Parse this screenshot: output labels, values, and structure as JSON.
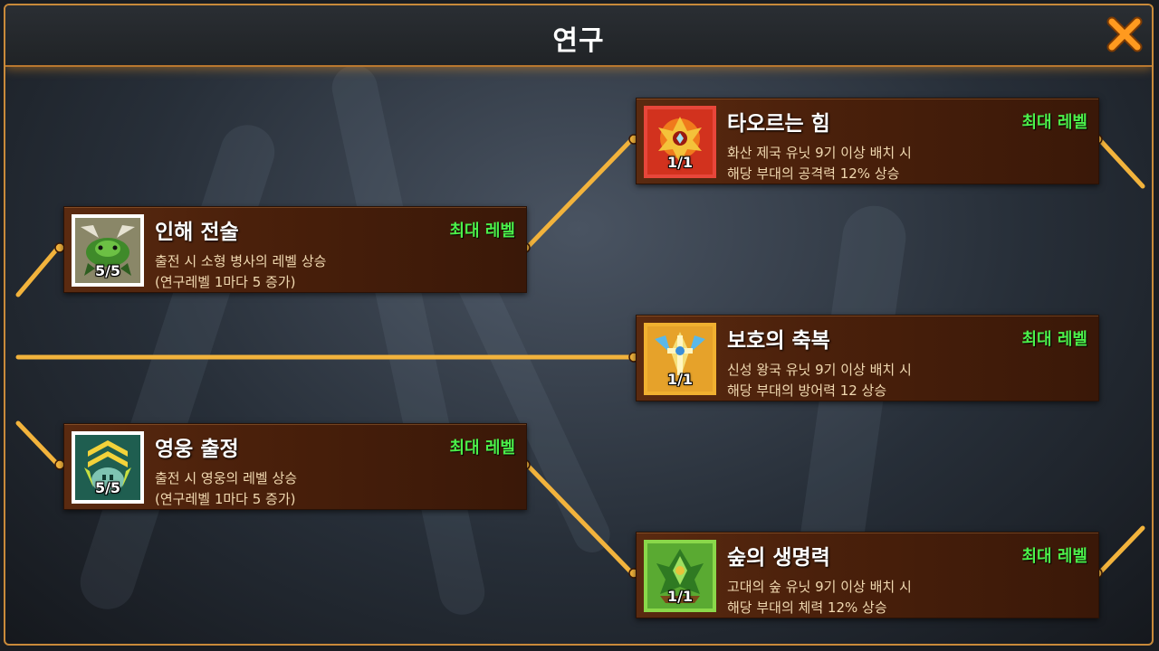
{
  "header": {
    "title": "연구"
  },
  "colors": {
    "accent": "#f2b33c",
    "max_level": "#4cf04a",
    "card": "#4a200b"
  },
  "research": [
    {
      "id": "rebirth",
      "name": "인해 전술",
      "status": "최대 레벨",
      "level": "5/5",
      "desc_line1": "출전 시 소형 병사의 레벨 상승",
      "desc_line2": "(연구레벨 1마다 5 증가)",
      "icon": "green-beast-icon"
    },
    {
      "id": "hero",
      "name": "영웅 출정",
      "status": "최대 레벨",
      "level": "5/5",
      "desc_line1": "출전 시 영웅의 레벨 상승",
      "desc_line2": "(연구레벨 1마다 5 증가)",
      "icon": "hero-rank-icon"
    },
    {
      "id": "fire",
      "name": "타오르는 힘",
      "status": "최대 레벨",
      "level": "1/1",
      "desc_line1": "화산 제국 유닛 9기 이상 배치 시",
      "desc_line2": "해당 부대의 공격력 12% 상승",
      "icon": "flame-crest-icon"
    },
    {
      "id": "holy",
      "name": "보호의 축복",
      "status": "최대 레벨",
      "level": "1/1",
      "desc_line1": "신성 왕국 유닛 9기 이상 배치 시",
      "desc_line2": "해당 부대의 방어력 12 상승",
      "icon": "holy-crest-icon"
    },
    {
      "id": "forest",
      "name": "숲의 생명력",
      "status": "최대 레벨",
      "level": "1/1",
      "desc_line1": "고대의 숲 유닛 9기 이상 배치 시",
      "desc_line2": "해당 부대의 체력 12% 상승",
      "icon": "forest-crest-icon"
    }
  ]
}
